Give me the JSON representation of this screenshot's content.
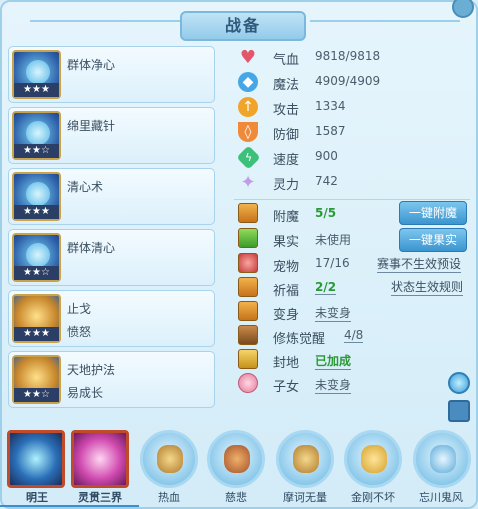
{
  "title": "战备",
  "skills": [
    {
      "name": "群体净心",
      "sub": "",
      "stars": "★★★"
    },
    {
      "name": "绵里藏针",
      "sub": "",
      "stars": "★★☆"
    },
    {
      "name": "清心术",
      "sub": "",
      "stars": "★★★"
    },
    {
      "name": "群体清心",
      "sub": "",
      "stars": "★★☆"
    },
    {
      "name": "止戈",
      "sub": "愤怒",
      "stars": "★★★"
    },
    {
      "name": "天地护法",
      "sub": "易成长",
      "stars": "★★☆"
    }
  ],
  "attributes": [
    {
      "label": "气血",
      "value": "9818/9818",
      "icon": "heart-icon",
      "color": "#e4566a"
    },
    {
      "label": "魔法",
      "value": "4909/4909",
      "icon": "diamond-icon",
      "color": "#45a6e8"
    },
    {
      "label": "攻击",
      "value": "1334",
      "icon": "sword-icon",
      "color": "#f0a52a"
    },
    {
      "label": "防御",
      "value": "1587",
      "icon": "shield-icon",
      "color": "#ef8a3a"
    },
    {
      "label": "速度",
      "value": "900",
      "icon": "lightning-icon",
      "color": "#3cc07a"
    },
    {
      "label": "灵力",
      "value": "742",
      "icon": "spirit-icon",
      "color": "#c29be8"
    }
  ],
  "items": [
    {
      "label": "附魔",
      "value": "5/5",
      "green": true
    },
    {
      "label": "果实",
      "value": "未使用",
      "green": false
    },
    {
      "label": "宠物",
      "value": "17/16",
      "green": false
    },
    {
      "label": "祈福",
      "value": "2/2",
      "green": true
    },
    {
      "label": "变身",
      "value": "未变身",
      "green": false
    },
    {
      "label": "修炼觉醒",
      "value": "4/8",
      "green": false
    },
    {
      "label": "封地",
      "value": "已加成",
      "green": true
    },
    {
      "label": "子女",
      "value": "未变身",
      "green": false
    }
  ],
  "buttons": {
    "enchant": "一键附魔",
    "fruit": "一键果实",
    "preset": "赛事不生效预设",
    "rules": "状态生效规则"
  },
  "formations": [
    "明王",
    "灵贯三界",
    "热血",
    "慈悲",
    "摩诃无量",
    "金刚不坏",
    "忘川鬼风"
  ]
}
